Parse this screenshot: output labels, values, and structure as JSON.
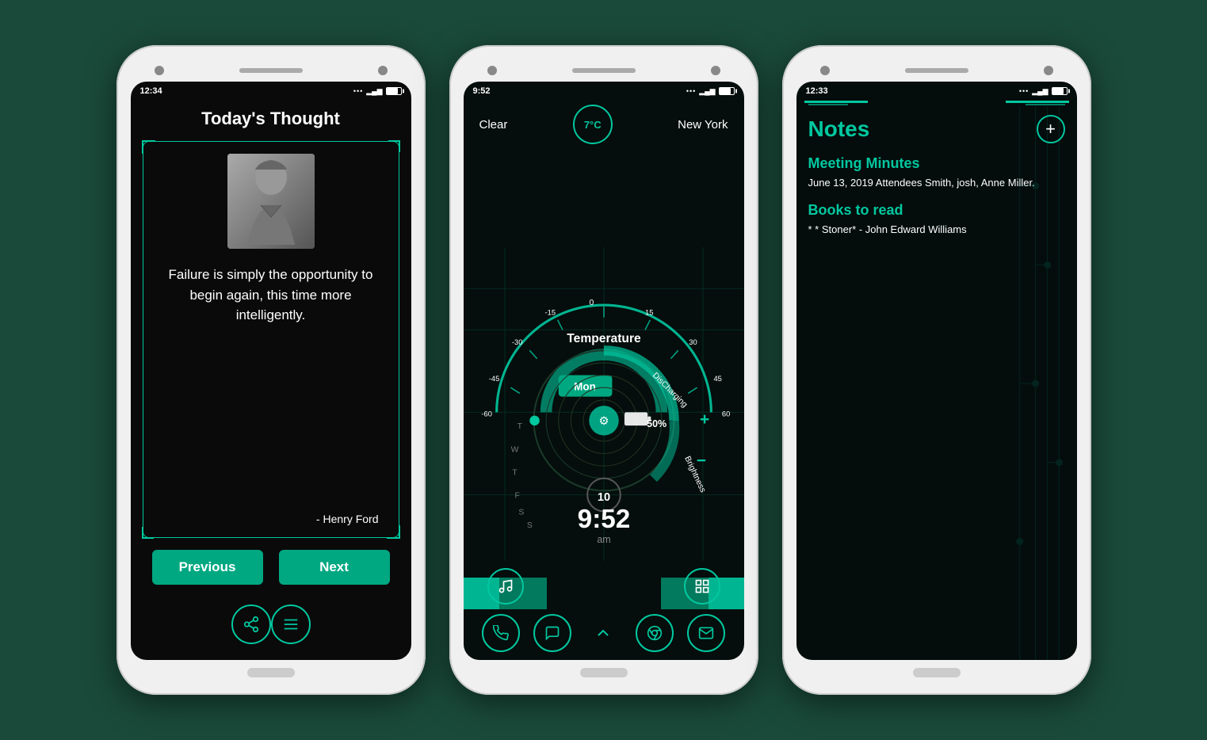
{
  "page": {
    "background_color": "#1a4a3a"
  },
  "phone1": {
    "status_time": "12:34",
    "title": "Today's Thought",
    "quote": "Failure is simply the opportunity to begin again, this time more intelligently.",
    "author": "- Henry Ford",
    "prev_button": "Previous",
    "next_button": "Next",
    "share_icon": "share",
    "menu_icon": "menu"
  },
  "phone2": {
    "status_time": "9:52",
    "weather_condition": "Clear",
    "temperature": "7°C",
    "city": "New York",
    "temp_label": "Temperature",
    "day_label": "Mon",
    "battery_status": "DisCharging",
    "battery_pct": "50%",
    "brightness_label": "Brightness",
    "time_display": "9:52",
    "time_period": "am",
    "num_display": "10",
    "weekdays": [
      "T",
      "W",
      "T",
      "F",
      "S",
      "S"
    ],
    "gauge_ticks": [
      "-60",
      "-45",
      "-30",
      "-15",
      "0",
      "15",
      "30",
      "45",
      "60"
    ],
    "plus": "+",
    "minus": "−"
  },
  "phone3": {
    "status_time": "12:33",
    "title": "Notes",
    "add_icon": "+",
    "note1_heading": "Meeting Minutes",
    "note1_body": "June 13, 2019 Attendees Smith, josh, Anne Miller.",
    "note2_heading": "Books to read",
    "note2_body": "* * Stoner* - John Edward Williams"
  }
}
